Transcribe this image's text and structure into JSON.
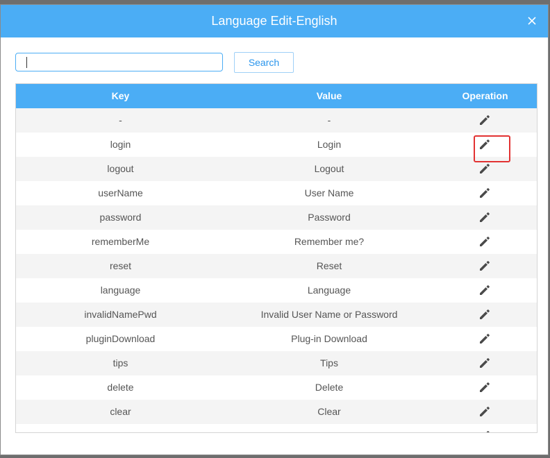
{
  "dialog": {
    "title": "Language Edit-English"
  },
  "search": {
    "value": "",
    "placeholder": "",
    "button_label": "Search"
  },
  "table": {
    "headers": {
      "key": "Key",
      "value": "Value",
      "operation": "Operation"
    },
    "rows": [
      {
        "key": "-",
        "value": "-"
      },
      {
        "key": "login",
        "value": "Login"
      },
      {
        "key": "logout",
        "value": "Logout"
      },
      {
        "key": "userName",
        "value": "User Name"
      },
      {
        "key": "password",
        "value": "Password"
      },
      {
        "key": "rememberMe",
        "value": "Remember me?"
      },
      {
        "key": "reset",
        "value": "Reset"
      },
      {
        "key": "language",
        "value": "Language"
      },
      {
        "key": "invalidNamePwd",
        "value": "Invalid User Name or Password"
      },
      {
        "key": "pluginDownload",
        "value": "Plug-in Download"
      },
      {
        "key": "tips",
        "value": "Tips"
      },
      {
        "key": "delete",
        "value": "Delete"
      },
      {
        "key": "clear",
        "value": "Clear"
      },
      {
        "key": "",
        "value": ""
      }
    ]
  },
  "icons": {
    "close": "close-icon",
    "edit": "pencil-icon"
  },
  "colors": {
    "accent": "#4badf5",
    "highlight": "#e23232"
  }
}
